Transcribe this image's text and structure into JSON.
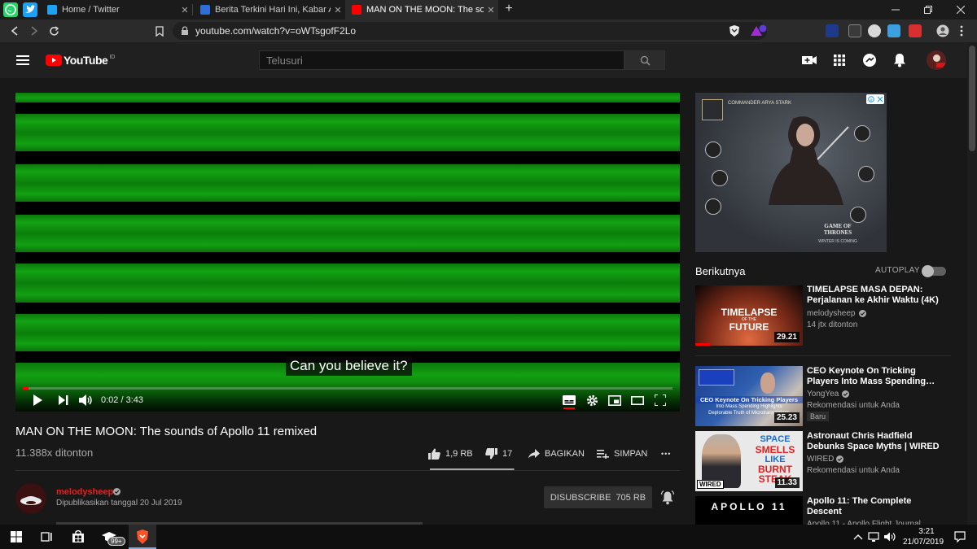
{
  "browser": {
    "tabs": [
      {
        "label": "Home / Twitter",
        "active": false
      },
      {
        "label": "Berita Terkini Hari Ini, Kabar Akurat",
        "active": false
      },
      {
        "label": "MAN ON THE MOON: The sounds",
        "active": true
      }
    ],
    "new_tab_glyph": "+",
    "url": "youtube.com/watch?v=oWTsgofF2Lo"
  },
  "youtube": {
    "logo_text": "YouTube",
    "region_code": "ID",
    "search_placeholder": "Telusuri"
  },
  "player": {
    "caption": "Can you believe it?",
    "time": "0:02 / 3:43",
    "progress": 0.009
  },
  "video": {
    "title": "MAN ON THE MOON: The sounds of Apollo 11 remixed",
    "views": "11.388x ditonton",
    "likes": "1,9 RB",
    "dislikes": "17",
    "like_ratio": 0.99,
    "share_label": "BAGIKAN",
    "save_label": "SIMPAN",
    "more_glyph": "•••"
  },
  "channel": {
    "name": "melodysheep",
    "published": "Dipublikasikan tanggal 20 Jul 2019",
    "subscribe_label": "DISUBSCRIBE",
    "subscribers": "705 RB"
  },
  "sidebar": {
    "ad": {
      "header": "COMMANDER ARYA STARK",
      "game_title": "GAME OF THRONES",
      "tagline": "WINTER IS COMING"
    },
    "next_label": "Berikutnya",
    "autoplay_label": "AUTOPLAY",
    "autoplay_on": false,
    "recommendations": [
      {
        "title": "TIMELAPSE MASA DEPAN: Perjalanan ke Akhir Waktu (4K)",
        "channel": "melodysheep",
        "meta": "14 jtx ditonton",
        "duration": "29.21",
        "thumb_text_1": "TIMELAPSE",
        "thumb_text_2": "OF THE",
        "thumb_text_3": "FUTURE"
      },
      {
        "title": "CEO Keynote On Tricking Players Into Mass Spending…",
        "channel": "YongYea",
        "meta": "Rekomendasi untuk Anda",
        "badge": "Baru",
        "duration": "25.23",
        "thumb_text_1": "CEO Keynote On Tricking Players",
        "thumb_text_2": "Into Mass Spending Highlights",
        "thumb_text_3": "Deplorable Truth of Microtransactions"
      },
      {
        "title": "Astronaut Chris Hadfield Debunks Space Myths | WIRED",
        "channel": "WIRED",
        "meta": "Rekomendasi untuk Anda",
        "duration": "11.33",
        "thumb_text_1": "SPACE",
        "thumb_text_2": "SMELLS",
        "thumb_text_3": "LIKE",
        "thumb_text_4": "BURNT",
        "thumb_text_5": "STEAK",
        "thumb_logo": "WIRED"
      },
      {
        "title": "Apollo 11: The Complete Descent",
        "meta": "Apollo 11 - Apollo Flight Journal",
        "thumb_text_1": "APOLLO 11"
      }
    ]
  },
  "taskbar": {
    "store_badge": "99+",
    "time": "3:21",
    "date": "21/07/2019"
  },
  "colors": {
    "brand_red": "#ff0000",
    "page_bg": "#181818",
    "video_green": "#0c8c0c"
  }
}
